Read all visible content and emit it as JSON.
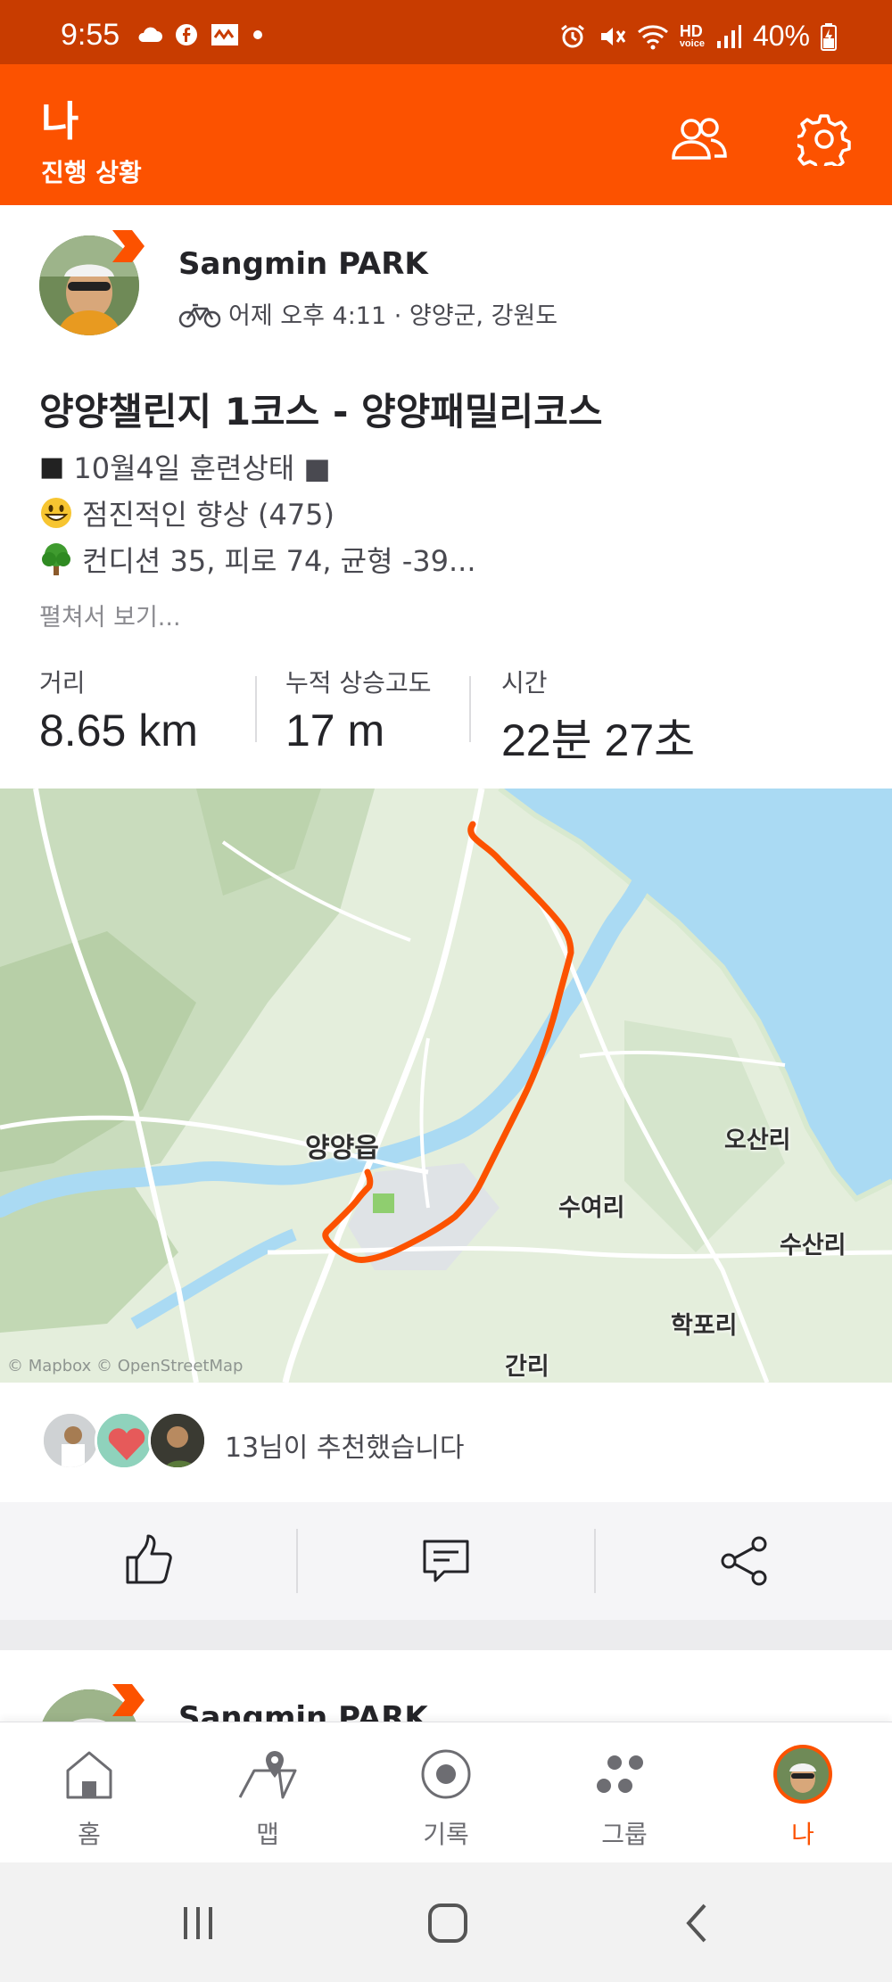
{
  "status_bar": {
    "time": "9:55",
    "battery": "40%",
    "hd_label": "HD",
    "voice_label": "voice"
  },
  "header": {
    "title": "나",
    "subtitle": "진행 상황",
    "icons": [
      "friends-icon",
      "gear-icon"
    ]
  },
  "activity": {
    "athlete_name": "Sangmin PARK",
    "sport_icon": "bike-icon",
    "meta": "어제 오후 4:11 · 양양군, 강원도",
    "title": "양양챌린지 1코스 - 양양패밀리코스",
    "description_lines": [
      {
        "emoji": "■",
        "text": "10월4일 훈련상태 ■"
      },
      {
        "emoji": "😀",
        "text": "점진적인 향상 (475)"
      },
      {
        "emoji": "🌳",
        "text": "컨디션 35, 피로 74, 균형 -39..."
      }
    ],
    "expand_label": "펼쳐서 보기...",
    "stats": [
      {
        "label": "거리",
        "value": "8.65 km"
      },
      {
        "label": "누적 상승고도",
        "value": "17 m"
      },
      {
        "label": "시간",
        "value": "22분 27초"
      }
    ]
  },
  "map": {
    "labels": {
      "town": "양양읍",
      "osanri": "오산리",
      "suyeori": "수여리",
      "susanri": "수산리",
      "hakpori": "학포리",
      "ganri": "간리"
    },
    "attribution": "© Mapbox © OpenStreetMap",
    "route_color": "#fc5200",
    "sea_color": "#aadaf3"
  },
  "kudos": {
    "text": "13님이 추천했습니다"
  },
  "actions": {
    "icons": [
      "thumbs-up-icon",
      "comment-icon",
      "share-icon"
    ]
  },
  "next_activity": {
    "athlete_name": "Sangmin PARK"
  },
  "bottom_nav": {
    "items": [
      {
        "label": "홈",
        "icon": "home-icon"
      },
      {
        "label": "맵",
        "icon": "map-icon"
      },
      {
        "label": "기록",
        "icon": "record-icon"
      },
      {
        "label": "그룹",
        "icon": "groups-icon"
      },
      {
        "label": "나",
        "icon": "profile-avatar"
      }
    ],
    "active_color": "#fc5200"
  },
  "brand_color": "#fc5200"
}
